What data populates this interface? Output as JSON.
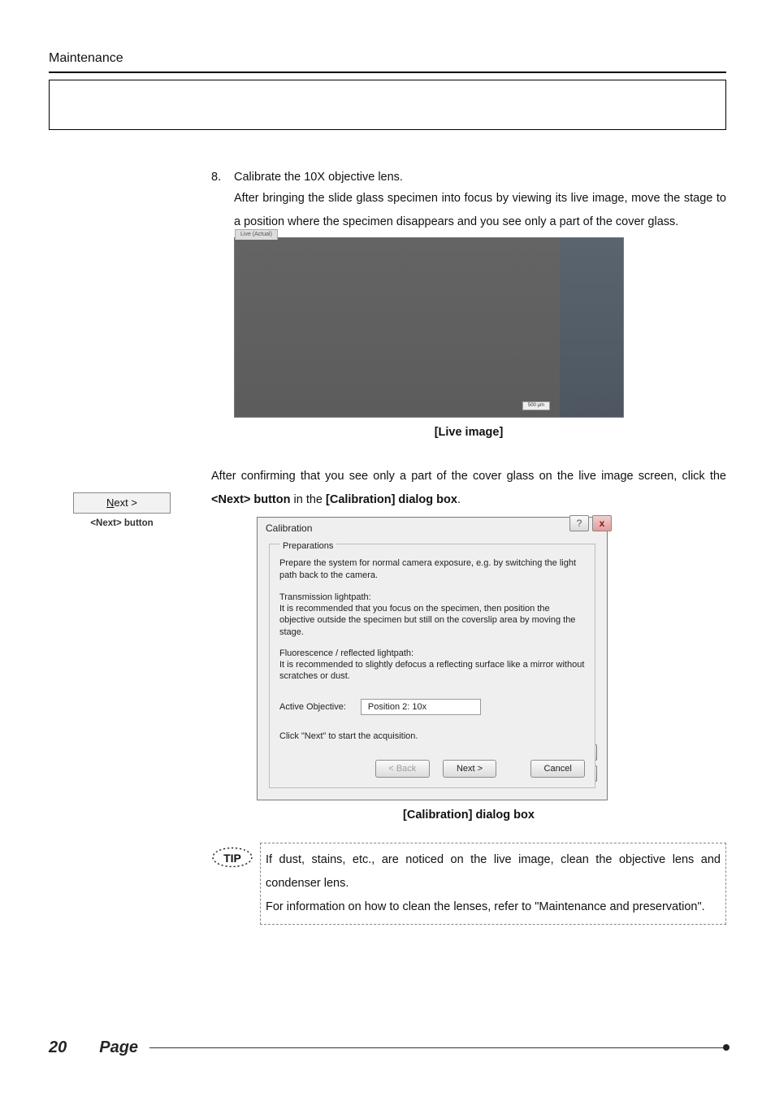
{
  "header": {
    "section": "Maintenance"
  },
  "step": {
    "num": "8.",
    "title": "Calibrate the 10X objective lens.",
    "para1": "After bringing the slide glass specimen into focus by viewing its live image, move the stage to a position where the specimen disappears and you see only a part of the cover glass."
  },
  "live": {
    "tab": "Live (Actual)",
    "scale": "500 µm",
    "caption": "[Live image]"
  },
  "after": {
    "line1": "After confirming that you see only a part of the cover glass on the live image screen,",
    "line2_pre": "click the ",
    "line2_b1": "<Next> button",
    "line2_mid": " in the ",
    "line2_b2": "[Calibration] dialog box",
    "line2_post": "."
  },
  "sidenote": {
    "btn_prefix": "N",
    "btn_rest": "ext >",
    "label": "<Next> button"
  },
  "dialog": {
    "title": "Calibration",
    "prep_legend": "Preparations",
    "prep_main": "Prepare the system for normal camera exposure, e.g. by switching the light path back to the camera.",
    "trans_head": "Transmission lightpath:",
    "trans_body": "It is recommended that you focus on the specimen, then position the objective outside the specimen but still on the coverslip area by moving the stage.",
    "fluo_head": "Fluorescence / reflected lightpath:",
    "fluo_body": "It is recommended to slightly defocus a reflecting surface like a mirror without scratches or dust.",
    "obj_label": "Active Objective:",
    "obj_value": "Position 2: 10x",
    "start": "Click \"Next\" to start the acquisition.",
    "back": "< Back",
    "next": "Next >",
    "cancel": "Cancel",
    "help": "?",
    "close": "x",
    "caption": "[Calibration] dialog box"
  },
  "tip": {
    "badge": "TIP",
    "text1": "If dust, stains, etc., are noticed on the live image, clean the objective lens and condenser lens.",
    "text2": "For information on how to clean the lenses, refer to \"Maintenance and preservation\"."
  },
  "footer": {
    "page": "20",
    "label": "Page"
  }
}
